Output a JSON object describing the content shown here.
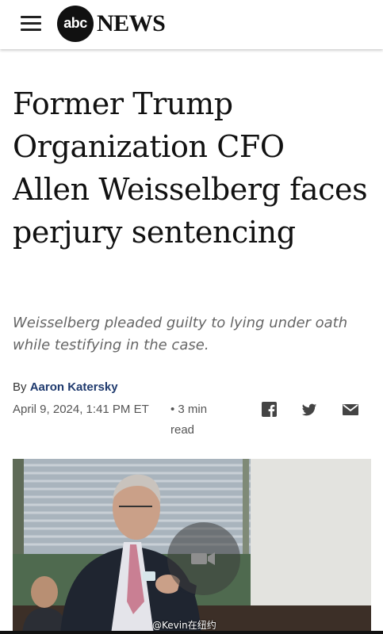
{
  "header": {
    "menu_icon": "hamburger-menu-icon",
    "logo_abc": "abc",
    "logo_news": "NEWS"
  },
  "article": {
    "headline": "Former Trump Organization CFO Allen Weisselberg faces perjury sentencing",
    "subheadline": "Weisselberg pleaded guilty to lying under oath while testifying in the case.",
    "byline_prefix": "By",
    "author": "Aaron Katersky",
    "date": "April 9, 2024, 1:41 PM ET",
    "read_time": "• 3 min read"
  },
  "share": {
    "icons": [
      "facebook-icon",
      "twitter-icon",
      "email-icon"
    ]
  },
  "media": {
    "play_icon": "video-camera-icon",
    "watermark": "@Kevin在纽约"
  },
  "colors": {
    "author_link": "#1f3a6e",
    "subhead": "#666666",
    "meta": "#555555"
  }
}
